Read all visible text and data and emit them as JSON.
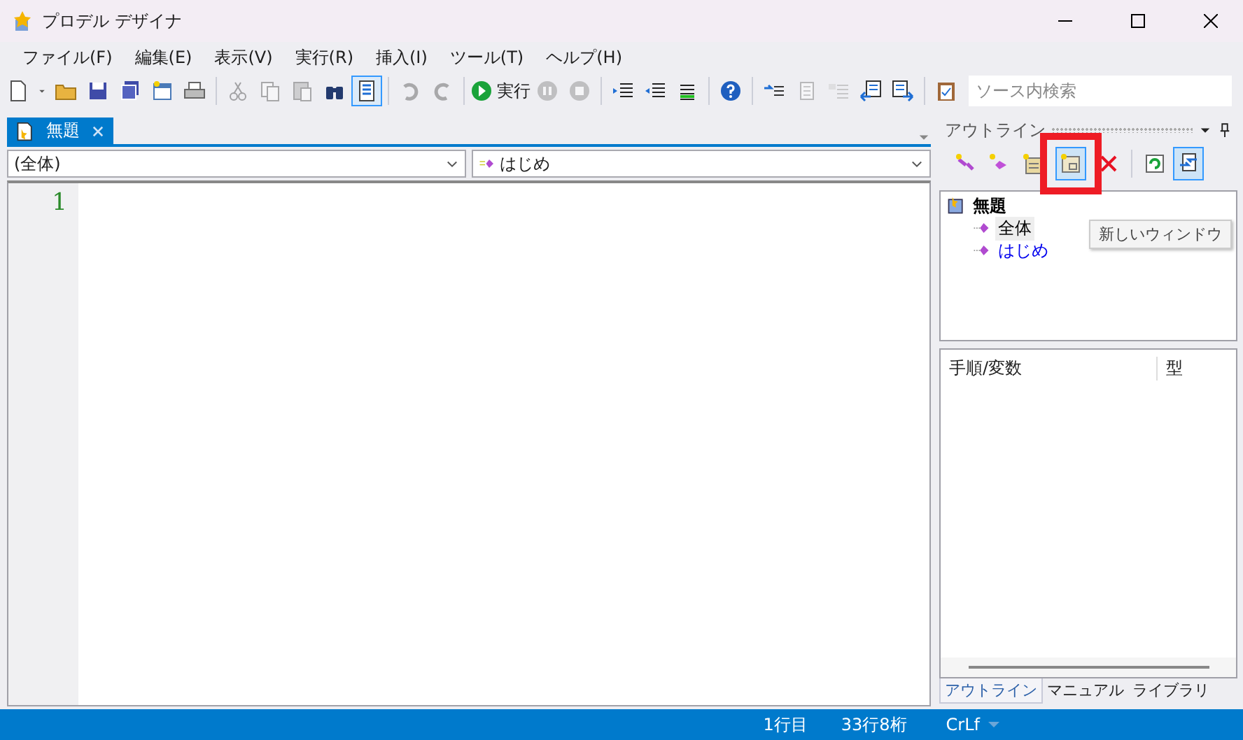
{
  "window": {
    "title": "プロデル デザイナ"
  },
  "menu": [
    "ファイル(F)",
    "編集(E)",
    "表示(V)",
    "実行(R)",
    "挿入(I)",
    "ツール(T)",
    "ヘルプ(H)"
  ],
  "toolbar": {
    "buttons": [
      {
        "disabled": false,
        "pressed": false
      },
      {
        "disabled": false,
        "pressed": false
      },
      {
        "disabled": false,
        "pressed": false
      },
      {
        "disabled": false,
        "pressed": false
      },
      {
        "disabled": false,
        "pressed": false
      },
      {
        "disabled": false,
        "pressed": false
      },
      {
        "disabled": false,
        "pressed": false
      },
      {
        "disabled": true,
        "pressed": false
      },
      {
        "disabled": true,
        "pressed": false
      },
      {
        "disabled": true,
        "pressed": false
      },
      {
        "disabled": false,
        "pressed": false
      },
      {
        "disabled": false,
        "pressed": true
      },
      {
        "disabled": true,
        "pressed": false
      },
      {
        "disabled": true,
        "pressed": false
      },
      {
        "disabled": false,
        "pressed": false,
        "label": "実行"
      },
      {
        "disabled": true,
        "pressed": false
      },
      {
        "disabled": true,
        "pressed": false
      },
      {
        "disabled": false,
        "pressed": false
      },
      {
        "disabled": false,
        "pressed": false
      },
      {
        "disabled": false,
        "pressed": false
      },
      {
        "disabled": false,
        "pressed": false
      },
      {
        "disabled": false,
        "pressed": false
      },
      {
        "disabled": true,
        "pressed": false
      },
      {
        "disabled": true,
        "pressed": false
      },
      {
        "disabled": false,
        "pressed": false
      },
      {
        "disabled": false,
        "pressed": false
      },
      {
        "disabled": false,
        "pressed": false
      }
    ],
    "search": {
      "placeholder": "ソース内検索"
    }
  },
  "editor": {
    "tabs": [
      {
        "label": "無題",
        "selected": true
      }
    ],
    "scope": "(全体)",
    "procedure": "はじめ",
    "line_numbers": [
      "1"
    ]
  },
  "outline": {
    "title": "アウトライン",
    "buttons": [
      {
        "pressed": false,
        "highlighted": false
      },
      {
        "pressed": false,
        "highlighted": false
      },
      {
        "pressed": false,
        "highlighted": false
      },
      {
        "pressed": true,
        "highlighted": true
      },
      {
        "pressed": false,
        "highlighted": false
      },
      {
        "pressed": false,
        "highlighted": false
      },
      {
        "pressed": true,
        "highlighted": false
      }
    ],
    "tree": [
      {
        "label": "無題",
        "selected": false,
        "children": [
          {
            "label": "全体",
            "selected": true
          },
          {
            "label": "はじめ",
            "selected": false
          }
        ]
      }
    ],
    "tooltip": "新しいウィンドウ",
    "columns": [
      "手順/変数",
      "型"
    ],
    "tabs": [
      {
        "label": "アウトライン",
        "selected": true
      },
      {
        "label": "マニュアル",
        "selected": false
      },
      {
        "label": "ライブラリ",
        "selected": false
      }
    ]
  },
  "status_bar": [
    "1行目",
    "33行8桁",
    "CrLf"
  ]
}
